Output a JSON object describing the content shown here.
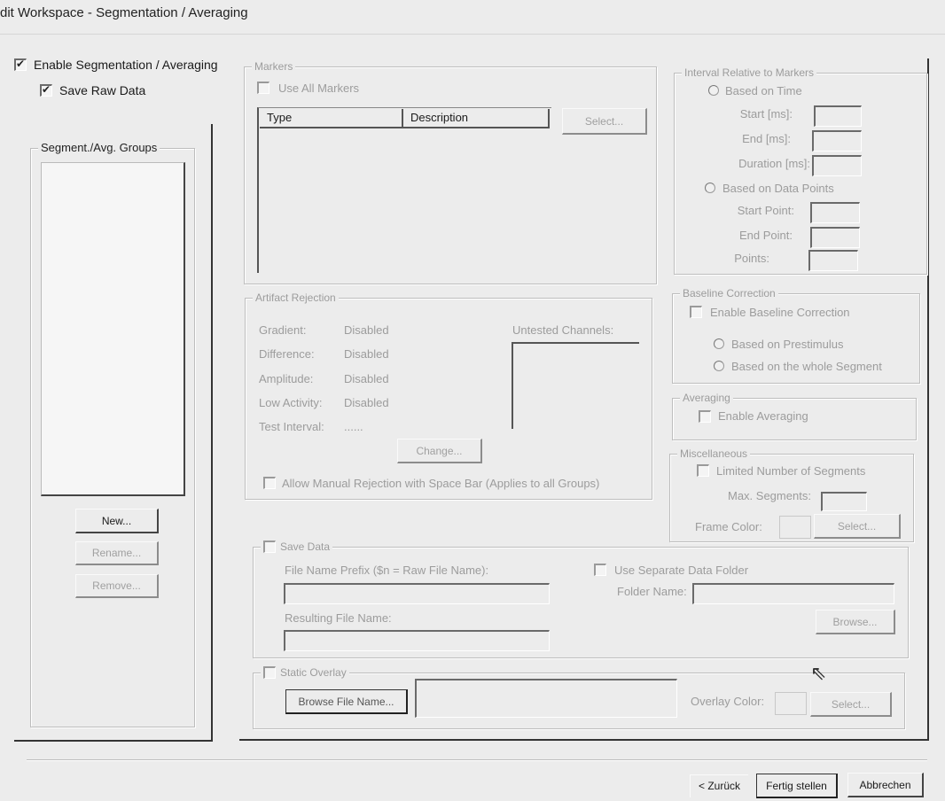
{
  "window": {
    "title": "dit Workspace - Segmentation / Averaging"
  },
  "left": {
    "enable_seg": {
      "label": "Enable Segmentation / Averaging",
      "checked": true
    },
    "save_raw": {
      "label": "Save Raw Data",
      "checked": true
    },
    "groups": {
      "title": "Segment./Avg. Groups",
      "items": []
    },
    "buttons": {
      "new": "New...",
      "rename": "Rename...",
      "remove": "Remove..."
    }
  },
  "markers": {
    "title": "Markers",
    "use_all": "Use All Markers",
    "columns": [
      "Type",
      "Description"
    ],
    "select": "Select..."
  },
  "interval": {
    "title": "Interval Relative to Markers",
    "time_radio": "Based on Time",
    "start_ms": "Start [ms]:",
    "end_ms": "End [ms]:",
    "duration_ms": "Duration [ms]:",
    "points_radio": "Based on Data Points",
    "start_point": "Start Point:",
    "end_point": "End Point:",
    "points": "Points:"
  },
  "artifact": {
    "title": "Artifact Rejection",
    "rows": [
      {
        "k": "Gradient:",
        "v": "Disabled"
      },
      {
        "k": "Difference:",
        "v": "Disabled"
      },
      {
        "k": "Amplitude:",
        "v": "Disabled"
      },
      {
        "k": "Low Activity:",
        "v": "Disabled"
      },
      {
        "k": "Test Interval:",
        "v": "......"
      }
    ],
    "untested": "Untested Channels:",
    "change": "Change...",
    "allow_manual": "Allow Manual Rejection with Space Bar (Applies to all Groups)"
  },
  "baseline": {
    "title": "Baseline Correction",
    "enable": "Enable Baseline Correction",
    "prestim": "Based on Prestimulus",
    "whole": "Based on the whole Segment"
  },
  "averaging": {
    "title": "Averaging",
    "enable": "Enable Averaging"
  },
  "misc": {
    "title": "Miscellaneous",
    "limited": "Limited Number of Segments",
    "max": "Max. Segments:",
    "frame_color": "Frame Color:",
    "select": "Select..."
  },
  "save_data": {
    "title": "Save Data",
    "prefix": "File Name Prefix ($n = Raw File Name):",
    "resulting": "Resulting File Name:",
    "use_separate": "Use Separate Data Folder",
    "folder": "Folder Name:",
    "browse": "Browse..."
  },
  "overlay": {
    "title": "Static Overlay",
    "browse": "Browse File Name...",
    "color": "Overlay Color:",
    "select": "Select..."
  },
  "footer": {
    "back": "< Zurück",
    "finish": "Fertig stellen",
    "cancel": "Abbrechen"
  }
}
